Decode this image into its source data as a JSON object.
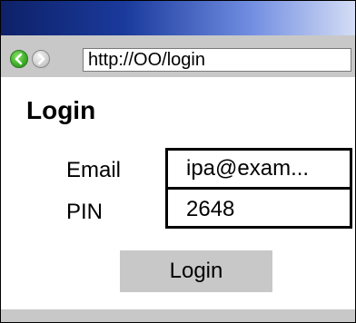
{
  "browser": {
    "url": "http://OO/login",
    "back_icon": "back-arrow-icon",
    "forward_icon": "forward-arrow-icon",
    "colors": {
      "titlebar_dark": "#0e2168",
      "titlebar_light": "#d4ddf5",
      "chrome_gray": "#c8c8c8",
      "back_green": "#3fb02a"
    }
  },
  "page": {
    "title": "Login"
  },
  "form": {
    "email_label": "Email",
    "email_value": "ipa@exam...",
    "pin_label": "PIN",
    "pin_value": "2648",
    "submit_label": "Login"
  }
}
